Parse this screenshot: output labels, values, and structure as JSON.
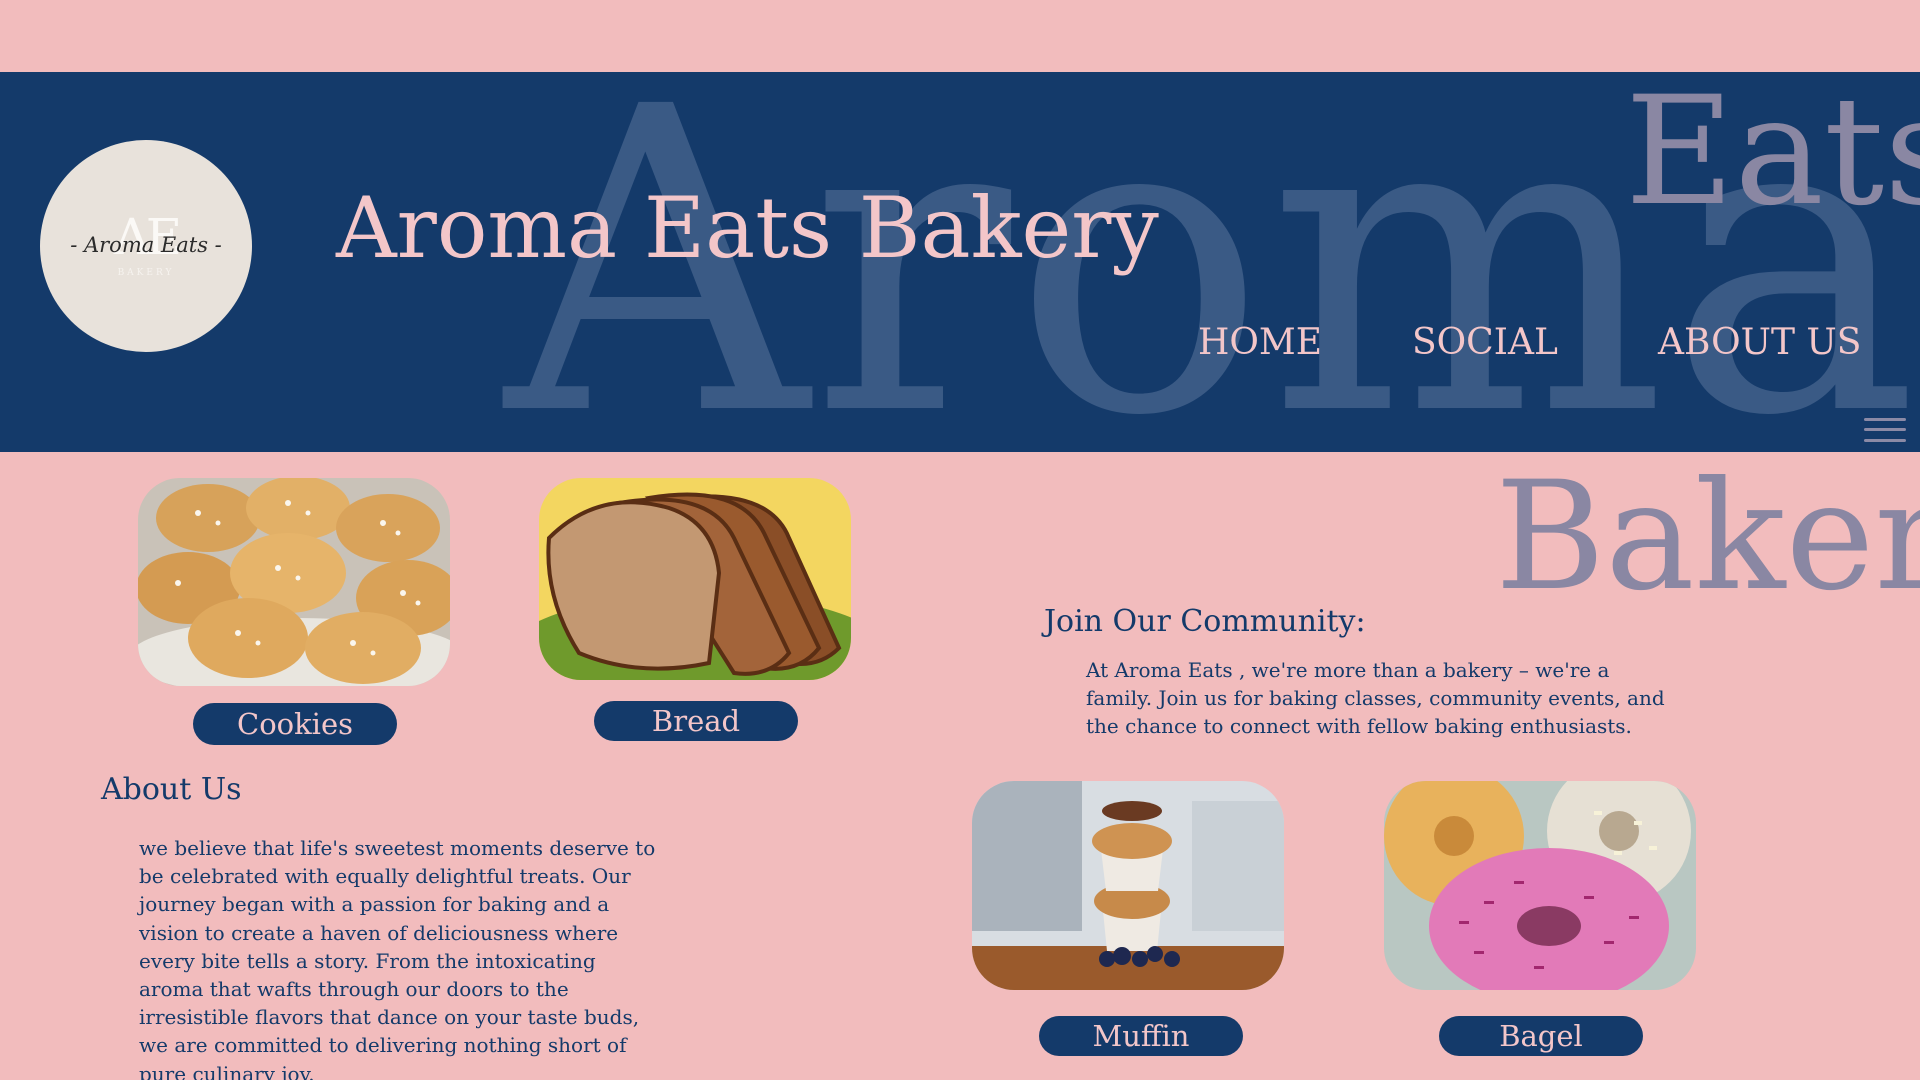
{
  "brand": {
    "title": "Aroma Eats Bakery",
    "logo_monogram": "AE",
    "logo_script": "- Aroma Eats -",
    "logo_subtitle": "BAKERY",
    "watermark_aroma": "Aroma",
    "watermark_eats": "Eats",
    "watermark_bakery": "Bakery"
  },
  "nav": {
    "home": "HOME",
    "social": "SOCIAL",
    "about": "ABOUT US",
    "menu_icon": "hamburger-menu-icon"
  },
  "products": [
    {
      "label": "Cookies"
    },
    {
      "label": "Bread"
    },
    {
      "label": "Muffin"
    },
    {
      "label": "Bagel"
    }
  ],
  "about": {
    "heading": "About Us",
    "body": "we believe that life's sweetest moments deserve to be celebrated with equally delightful treats. Our journey began with a passion for baking and a vision to create a haven of deliciousness where every bite tells a story. From the intoxicating aroma that wafts through our doors to the irresistible flavors that dance on your taste buds, we are committed to delivering nothing short of pure culinary joy."
  },
  "community": {
    "heading": "Join Our Community:",
    "body": "At Aroma Eats , we're more than a bakery – we're a family. Join us for baking classes, community events, and the chance to connect with fellow baking enthusiasts."
  },
  "colors": {
    "background": "#f2bcbd",
    "navy": "#143a6a",
    "pink_text": "#f3c6c9",
    "watermark": "#8a87a3"
  }
}
